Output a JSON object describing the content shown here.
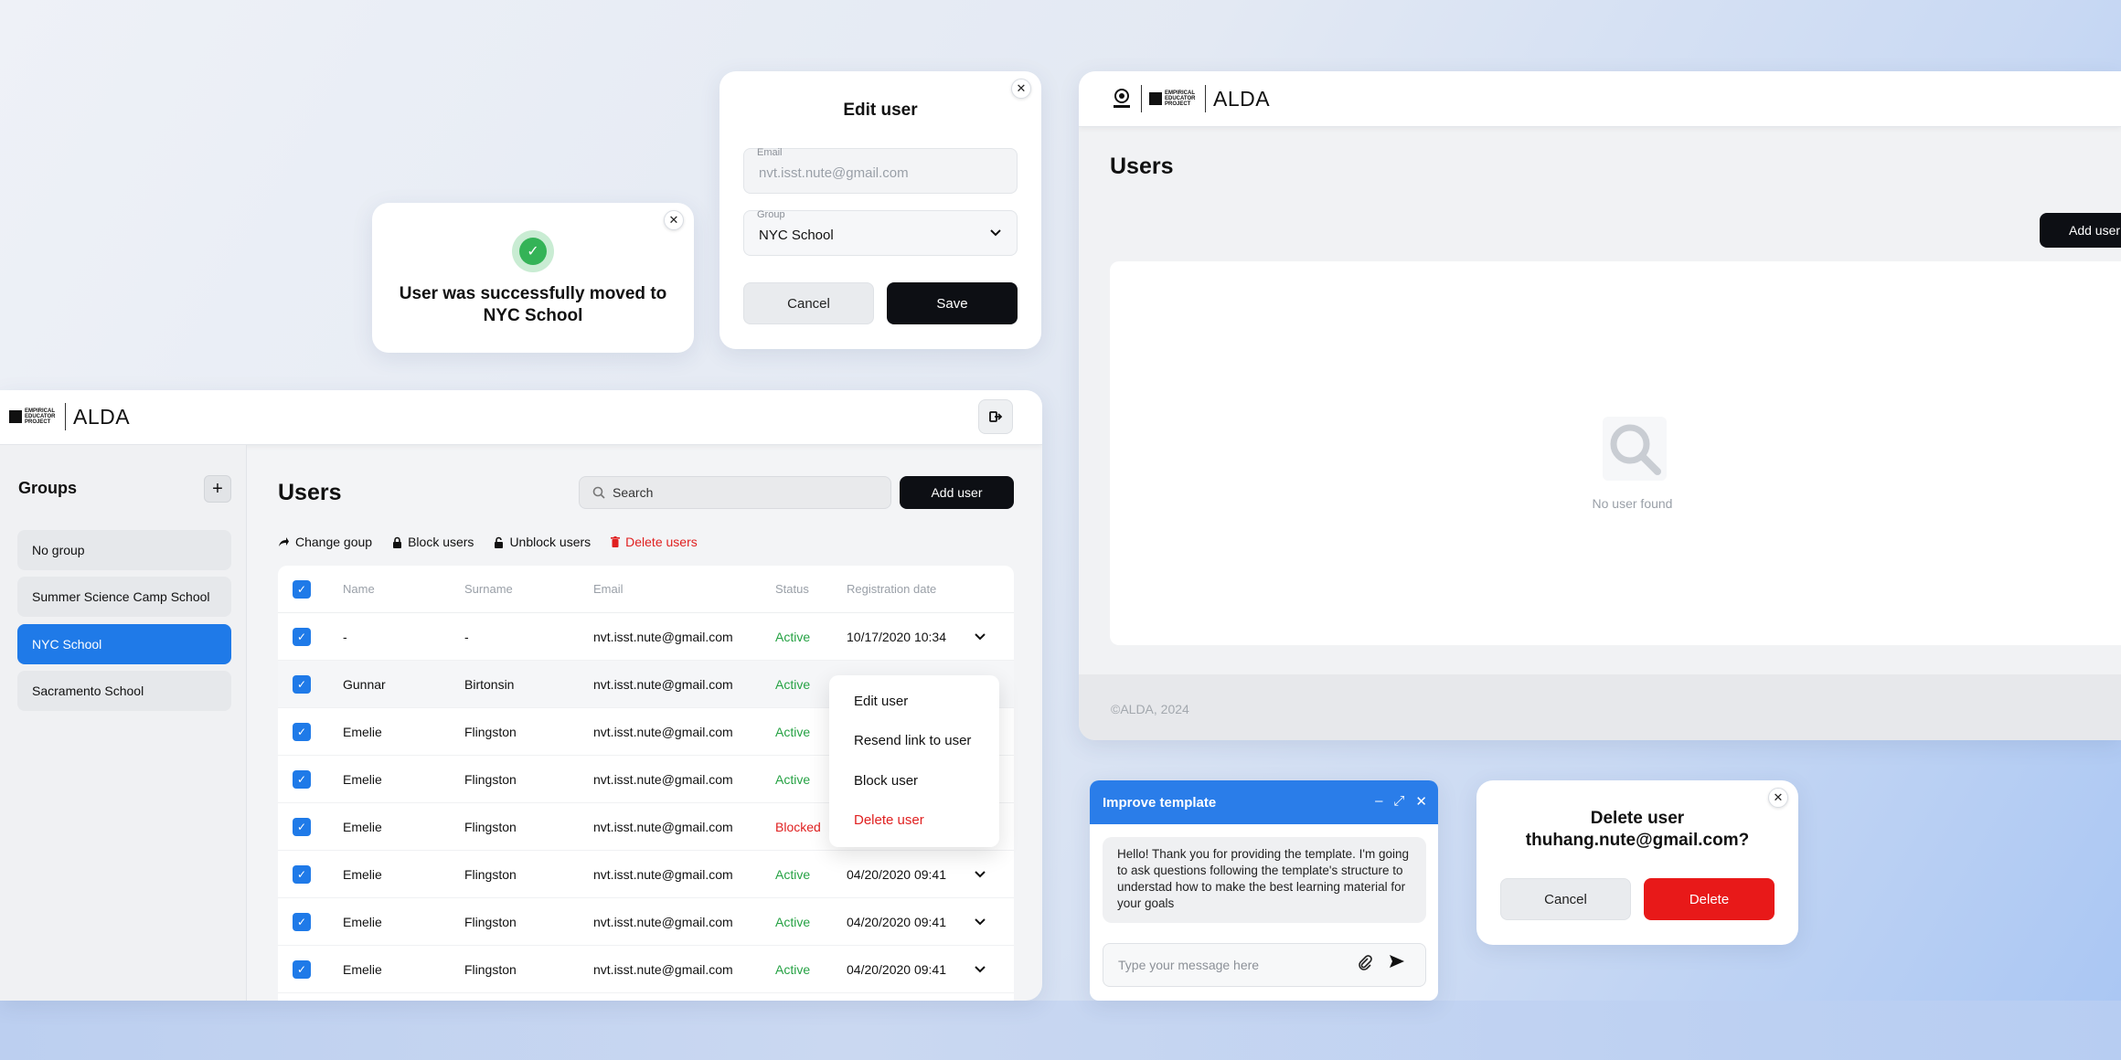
{
  "success_card": {
    "message": "User was successfully moved to NYC School",
    "close": "✕",
    "check": "✓"
  },
  "edit_dialog": {
    "title": "Edit user",
    "email_label": "Email",
    "email_value": "nvt.isst.nute@gmail.com",
    "group_label": "Group",
    "group_value": "NYC School",
    "cancel": "Cancel",
    "save": "Save",
    "close": "✕"
  },
  "app": {
    "brand": "ALDA",
    "logo_text": "EMPIRICAL EDUCATOR PROJECT",
    "sidebar": {
      "title": "Groups",
      "add": "+",
      "items": [
        {
          "label": "No group"
        },
        {
          "label": "Summer Science Camp School"
        },
        {
          "label": "NYC School"
        },
        {
          "label": "Sacramento School"
        }
      ]
    },
    "main": {
      "title": "Users",
      "search_placeholder": "Search",
      "add_user": "Add user",
      "actions": {
        "change_group": "Change goup",
        "block": "Block users",
        "unblock": "Unblock users",
        "delete": "Delete users"
      }
    },
    "table": {
      "columns": {
        "name": "Name",
        "surname": "Surname",
        "email": "Email",
        "status": "Status",
        "date": "Registration date"
      },
      "rows": [
        {
          "name": "-",
          "surname": "-",
          "email": "nvt.isst.nute@gmail.com",
          "status": "Active",
          "date": "10/17/2020 10:34"
        },
        {
          "name": "Gunnar",
          "surname": "Birtonsin",
          "email": "nvt.isst.nute@gmail.com",
          "status": "Active",
          "date": ""
        },
        {
          "name": "Emelie",
          "surname": "Flingston",
          "email": "nvt.isst.nute@gmail.com",
          "status": "Active",
          "date": ""
        },
        {
          "name": "Emelie",
          "surname": "Flingston",
          "email": "nvt.isst.nute@gmail.com",
          "status": "Active",
          "date": ""
        },
        {
          "name": "Emelie",
          "surname": "Flingston",
          "email": "nvt.isst.nute@gmail.com",
          "status": "Blocked",
          "date": ""
        },
        {
          "name": "Emelie",
          "surname": "Flingston",
          "email": "nvt.isst.nute@gmail.com",
          "status": "Active",
          "date": "04/20/2020 09:41"
        },
        {
          "name": "Emelie",
          "surname": "Flingston",
          "email": "nvt.isst.nute@gmail.com",
          "status": "Active",
          "date": "04/20/2020 09:41"
        },
        {
          "name": "Emelie",
          "surname": "Flingston",
          "email": "nvt.isst.nute@gmail.com",
          "status": "Active",
          "date": "04/20/2020 09:41"
        }
      ]
    },
    "context_menu": {
      "edit": "Edit user",
      "resend": "Resend link to user",
      "block": "Block user",
      "delete": "Delete user"
    }
  },
  "users_panel": {
    "brand": "ALDA",
    "title": "Users",
    "add_user": "Add user",
    "empty": "No user found",
    "footer": "©ALDA, 2024"
  },
  "chat": {
    "title": "Improve template",
    "minimize": "–",
    "expand": "⤢",
    "close": "✕",
    "message": "Hello! Thank you for providing the template. I'm going to ask questions following the template's structure to understad how to make the best learning material for your goals",
    "input_placeholder": "Type your message here"
  },
  "delete_dialog": {
    "title": "Delete user thuhang.nute@gmail.com?",
    "cancel": "Cancel",
    "delete": "Delete",
    "close": "✕"
  },
  "colors": {
    "accent": "#1f7ae8",
    "danger": "#e81919",
    "success": "#26a244",
    "dark": "#0d0f14"
  }
}
